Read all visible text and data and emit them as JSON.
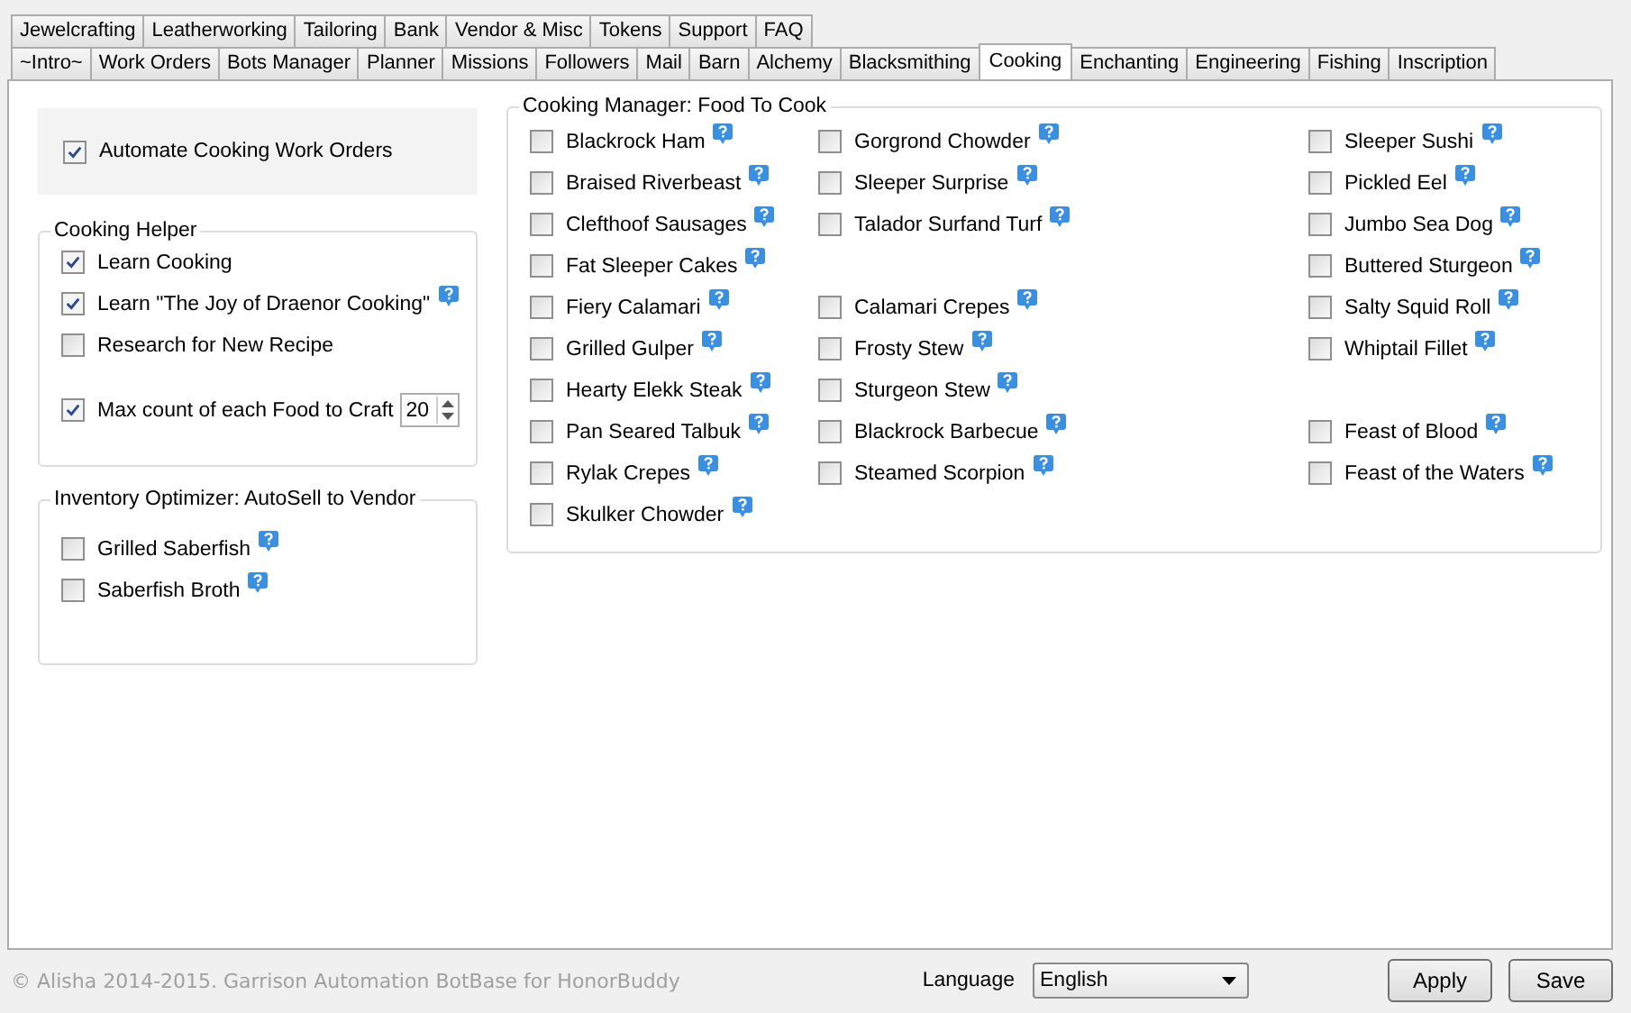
{
  "tab_rows": [
    [
      {
        "label": "Jewelcrafting",
        "selected": false
      },
      {
        "label": "Leatherworking",
        "selected": false
      },
      {
        "label": "Tailoring",
        "selected": false
      },
      {
        "label": "Bank",
        "selected": false
      },
      {
        "label": "Vendor & Misc",
        "selected": false
      },
      {
        "label": "Tokens",
        "selected": false
      },
      {
        "label": "Support",
        "selected": false
      },
      {
        "label": "FAQ",
        "selected": false
      }
    ],
    [
      {
        "label": "~Intro~",
        "selected": false
      },
      {
        "label": "Work Orders",
        "selected": false
      },
      {
        "label": "Bots Manager",
        "selected": false
      },
      {
        "label": "Planner",
        "selected": false
      },
      {
        "label": "Missions",
        "selected": false
      },
      {
        "label": "Followers",
        "selected": false
      },
      {
        "label": "Mail",
        "selected": false
      },
      {
        "label": "Barn",
        "selected": false
      },
      {
        "label": "Alchemy",
        "selected": false
      },
      {
        "label": "Blacksmithing",
        "selected": false
      },
      {
        "label": "Cooking",
        "selected": true
      },
      {
        "label": "Enchanting",
        "selected": false
      },
      {
        "label": "Engineering",
        "selected": false
      },
      {
        "label": "Fishing",
        "selected": false
      },
      {
        "label": "Inscription",
        "selected": false
      }
    ]
  ],
  "automate": {
    "label": "Automate Cooking Work Orders",
    "checked": true
  },
  "cooking_helper": {
    "title": "Cooking Helper",
    "items": [
      {
        "label": "Learn Cooking",
        "checked": true,
        "help": false
      },
      {
        "label": "Learn \"The Joy of Draenor Cooking\"",
        "checked": true,
        "help": true
      },
      {
        "label": "Research for New Recipe",
        "checked": false,
        "help": false
      }
    ],
    "max_count": {
      "label": "Max count of each Food to Craft",
      "checked": true,
      "value": "20"
    }
  },
  "inventory_optimizer": {
    "title": "Inventory Optimizer: AutoSell to Vendor",
    "items": [
      {
        "label": "Grilled Saberfish",
        "checked": false,
        "help": true
      },
      {
        "label": "Saberfish Broth",
        "checked": false,
        "help": true
      }
    ]
  },
  "cooking_manager": {
    "title": "Cooking Manager: Food To Cook",
    "rows": [
      [
        {
          "kind": "food",
          "label": "Blackrock Ham",
          "checked": false
        },
        {
          "kind": "food",
          "label": "Gorgrond Chowder",
          "checked": false
        },
        {
          "kind": "food",
          "label": "Sleeper Sushi",
          "checked": false
        }
      ],
      [
        {
          "kind": "food",
          "label": "Braised Riverbeast",
          "checked": false
        },
        {
          "kind": "food",
          "label": "Sleeper Surprise",
          "checked": false
        },
        {
          "kind": "food",
          "label": "Pickled Eel",
          "checked": false
        }
      ],
      [
        {
          "kind": "food",
          "label": "Clefthoof Sausages",
          "checked": false
        },
        {
          "kind": "food",
          "label": "Talador Surfand Turf",
          "checked": false
        },
        {
          "kind": "food",
          "label": "Jumbo Sea Dog",
          "checked": false
        }
      ],
      [
        {
          "kind": "food",
          "label": "Fat Sleeper Cakes",
          "checked": false
        },
        {
          "kind": "blank"
        },
        {
          "kind": "food",
          "label": "Buttered Sturgeon",
          "checked": false
        }
      ],
      [
        {
          "kind": "food",
          "label": "Fiery Calamari",
          "checked": false
        },
        {
          "kind": "food",
          "label": "Calamari Crepes",
          "checked": false
        },
        {
          "kind": "food",
          "label": "Salty Squid Roll",
          "checked": false
        }
      ],
      [
        {
          "kind": "food",
          "label": "Grilled Gulper",
          "checked": false
        },
        {
          "kind": "food",
          "label": "Frosty Stew",
          "checked": false
        },
        {
          "kind": "food",
          "label": "Whiptail Fillet",
          "checked": false
        }
      ],
      [
        {
          "kind": "food",
          "label": "Hearty Elekk Steak",
          "checked": false
        },
        {
          "kind": "food",
          "label": "Sturgeon Stew",
          "checked": false
        },
        {
          "kind": "blank"
        }
      ],
      [
        {
          "kind": "food",
          "label": "Pan Seared Talbuk",
          "checked": false
        },
        {
          "kind": "food",
          "label": "Blackrock Barbecue",
          "checked": false
        },
        {
          "kind": "food",
          "label": "Feast of Blood",
          "checked": false
        }
      ],
      [
        {
          "kind": "food",
          "label": "Rylak Crepes",
          "checked": false
        },
        {
          "kind": "food",
          "label": "Steamed Scorpion",
          "checked": false
        },
        {
          "kind": "food",
          "label": "Feast of the Waters",
          "checked": false
        }
      ],
      [
        {
          "kind": "food",
          "label": "Skulker Chowder",
          "checked": false
        },
        {
          "kind": "blank"
        },
        {
          "kind": "blank"
        }
      ]
    ]
  },
  "footer": {
    "copyright": "© Alisha 2014-2015. Garrison Automation BotBase for HonorBuddy",
    "language_label": "Language",
    "language": "English",
    "buttons": [
      "Apply",
      "Save"
    ]
  }
}
